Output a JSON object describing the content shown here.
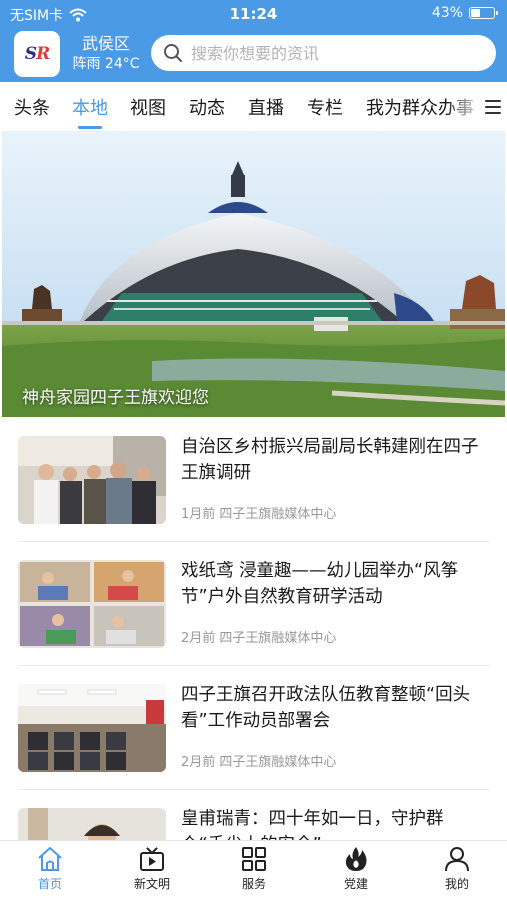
{
  "status_bar": {
    "carrier": "无SIM卡",
    "time": "11:24",
    "battery": "43%",
    "battery_level": 0.43
  },
  "header": {
    "location": "武侯区",
    "weather": "阵雨 24°C",
    "search_placeholder": "搜索你想要的资讯",
    "colors": {
      "primary": "#4a9ae6"
    }
  },
  "tabs": [
    "头条",
    "本地",
    "视图",
    "动态",
    "直播",
    "专栏",
    "我为群众办事"
  ],
  "active_tab": "本地",
  "banner": {
    "caption": "神舟家园四子王旗欢迎您"
  },
  "news": [
    {
      "title": "自治区乡村振兴局副局长韩建刚在四子王旗调研",
      "time": "1月前",
      "source": "四子王旗融媒体中心"
    },
    {
      "title": "戏纸鸢 浸童趣——幼儿园举办“风筝节”户外自然教育研学活动",
      "time": "2月前",
      "source": "四子王旗融媒体中心"
    },
    {
      "title": "四子王旗召开政法队伍教育整顿“回头看”工作动员部署会",
      "time": "2月前",
      "source": "四子王旗融媒体中心"
    },
    {
      "title": "皇甫瑞青：四十年如一日，守护群众“舌尖上的安全”",
      "time": "",
      "source": ""
    }
  ],
  "tabbar": [
    {
      "label": "首页",
      "icon": "home-icon"
    },
    {
      "label": "新文明",
      "icon": "tv-icon"
    },
    {
      "label": "服务",
      "icon": "grid-icon"
    },
    {
      "label": "党建",
      "icon": "flame-icon"
    },
    {
      "label": "我的",
      "icon": "user-icon"
    }
  ]
}
